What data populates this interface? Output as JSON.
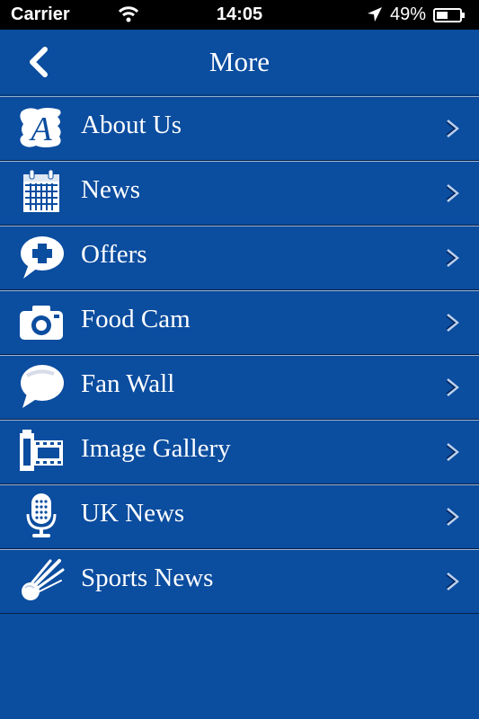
{
  "status": {
    "carrier": "Carrier",
    "time": "14:05",
    "battery": "49%"
  },
  "nav": {
    "title": "More"
  },
  "menu": [
    {
      "label": "About Us",
      "icon": "about-us-icon"
    },
    {
      "label": "News",
      "icon": "calendar-icon"
    },
    {
      "label": "Offers",
      "icon": "offer-bubble-icon"
    },
    {
      "label": "Food Cam",
      "icon": "camera-icon"
    },
    {
      "label": "Fan Wall",
      "icon": "speech-bubble-icon"
    },
    {
      "label": "Image Gallery",
      "icon": "film-gallery-icon"
    },
    {
      "label": "UK News",
      "icon": "microphone-icon"
    },
    {
      "label": "Sports News",
      "icon": "comet-icon"
    }
  ],
  "colors": {
    "background": "#0b4d9f",
    "text": "#ffffff"
  }
}
